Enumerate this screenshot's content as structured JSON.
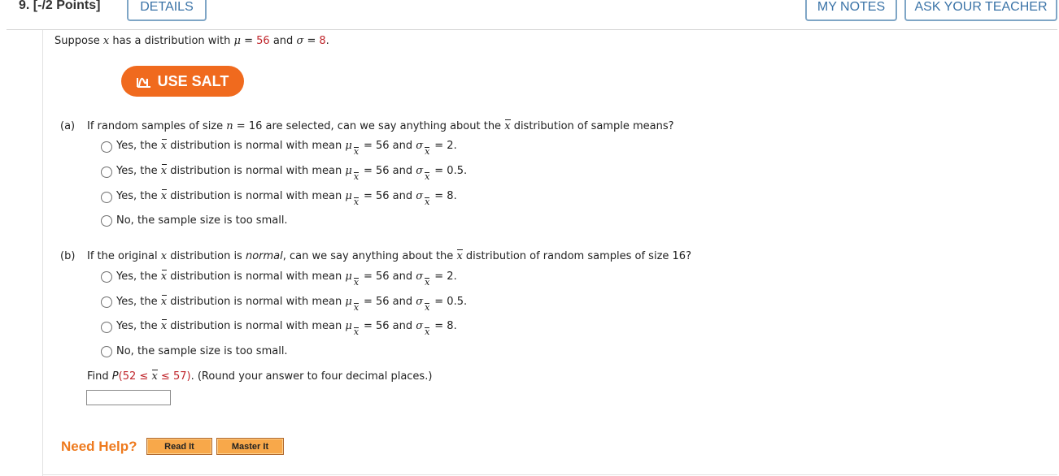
{
  "header": {
    "question_number": "9. [-/2 Points]",
    "details_label": "DETAILS",
    "my_notes_label": "MY NOTES",
    "ask_teacher_label": "ASK YOUR TEACHER"
  },
  "intro": {
    "prefix": "Suppose",
    "var": "x",
    "middle": "has a distribution with",
    "mu_sym": "μ",
    "eq": "=",
    "mu_value": "56",
    "and": "and",
    "sigma_sym": "σ",
    "sigma_value": "8",
    "end": "."
  },
  "salt_button": {
    "label": "USE SALT",
    "icon": "salt-chart-icon",
    "color": "#f06a1e"
  },
  "part_a": {
    "letter": "(a)",
    "q1": "If random samples of size",
    "n_var": "n",
    "q2": "= 16 are selected, can we say anything about the",
    "xbar": "x",
    "q3": "distribution of sample means?",
    "options": [
      {
        "pre": "Yes, the",
        "mid": "distribution is normal with mean",
        "mu_eq": "= 56 and",
        "sigma_eq": "= 2."
      },
      {
        "pre": "Yes, the",
        "mid": "distribution is normal with mean",
        "mu_eq": "= 56 and",
        "sigma_eq": "= 0.5."
      },
      {
        "pre": "Yes, the",
        "mid": "distribution is normal with mean",
        "mu_eq": "= 56 and",
        "sigma_eq": "= 8."
      },
      {
        "text": "No, the sample size is too small."
      }
    ]
  },
  "part_b": {
    "letter": "(b)",
    "q1": "If the original",
    "x_var": "x",
    "q2": "distribution is",
    "normal": "normal",
    "q3": ", can we say anything about the",
    "xbar": "x",
    "q4": "distribution of random samples of size 16?",
    "options": [
      {
        "pre": "Yes, the",
        "mid": "distribution is normal with mean",
        "mu_eq": "= 56 and",
        "sigma_eq": "= 2."
      },
      {
        "pre": "Yes, the",
        "mid": "distribution is normal with mean",
        "mu_eq": "= 56 and",
        "sigma_eq": "= 0.5."
      },
      {
        "pre": "Yes, the",
        "mid": "distribution is normal with mean",
        "mu_eq": "= 56 and",
        "sigma_eq": "= 8."
      },
      {
        "text": "No, the sample size is too small."
      }
    ],
    "find_pre": "Find",
    "P": "P",
    "find_red_open": "(52",
    "le1": "≤",
    "le2": "≤",
    "find_red_close": "57)",
    "find_post": ". (Round your answer to four decimal places.)",
    "answer_value": ""
  },
  "help": {
    "label": "Need Help?",
    "read_it": "Read It",
    "master_it": "Master It"
  },
  "colors": {
    "accent_blue": "#3a73a7",
    "red": "#c0262c",
    "help_orange": "#ee7a1e"
  }
}
